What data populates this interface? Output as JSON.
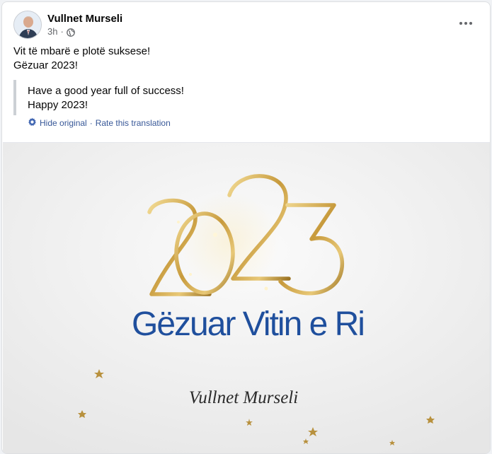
{
  "post": {
    "author": "Vullnet Murseli",
    "time": "3h",
    "separator": "·",
    "message_line1": "Vit të mbarë e plotë suksese!",
    "message_line2": "Gëzuar 2023!",
    "translation_line1": "Have a good year full of success!",
    "translation_line2": "Happy 2023!",
    "hide_original": "Hide original",
    "link_separator": "·",
    "rate_translation": "Rate this translation"
  },
  "greeting_card": {
    "year": "2023",
    "headline": "Gëzuar Vitin e Ri",
    "signature": "Vullnet Murseli"
  },
  "icons": {
    "privacy": "globe-icon",
    "more": "more-options-icon",
    "translation": "gear-icon"
  },
  "colors": {
    "link": "#385898",
    "headline": "#1f4f9d",
    "gold": "#c9a24a"
  }
}
